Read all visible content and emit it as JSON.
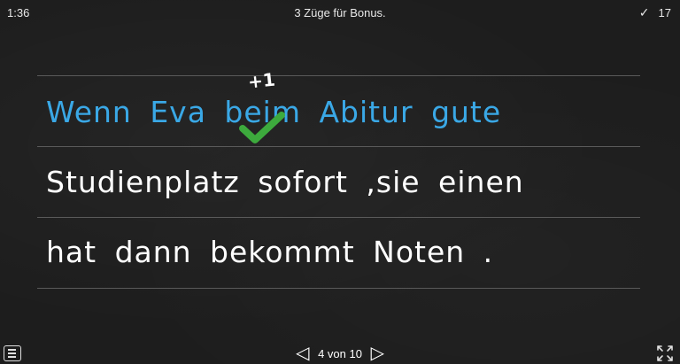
{
  "header": {
    "timer": "1:36",
    "bonus_message": "3 Züge für Bonus.",
    "score": "17"
  },
  "board": {
    "lines": [
      {
        "text": "Wenn Eva beim Abitur gute",
        "color": "#3aa8e6"
      },
      {
        "text": "Studienplatz sofort ,sie einen",
        "color": "#ffffff"
      },
      {
        "text": "hat dann bekommt Noten .",
        "color": "#ffffff"
      }
    ],
    "bonus_points": "+1",
    "correct_marker": "check-icon",
    "correct_color": "#3daa3d"
  },
  "footer": {
    "page_label": "4 von 10",
    "prev_icon": "triangle-left-icon",
    "next_icon": "triangle-right-icon",
    "menu_icon": "menu-icon",
    "fullscreen_icon": "fullscreen-icon"
  }
}
